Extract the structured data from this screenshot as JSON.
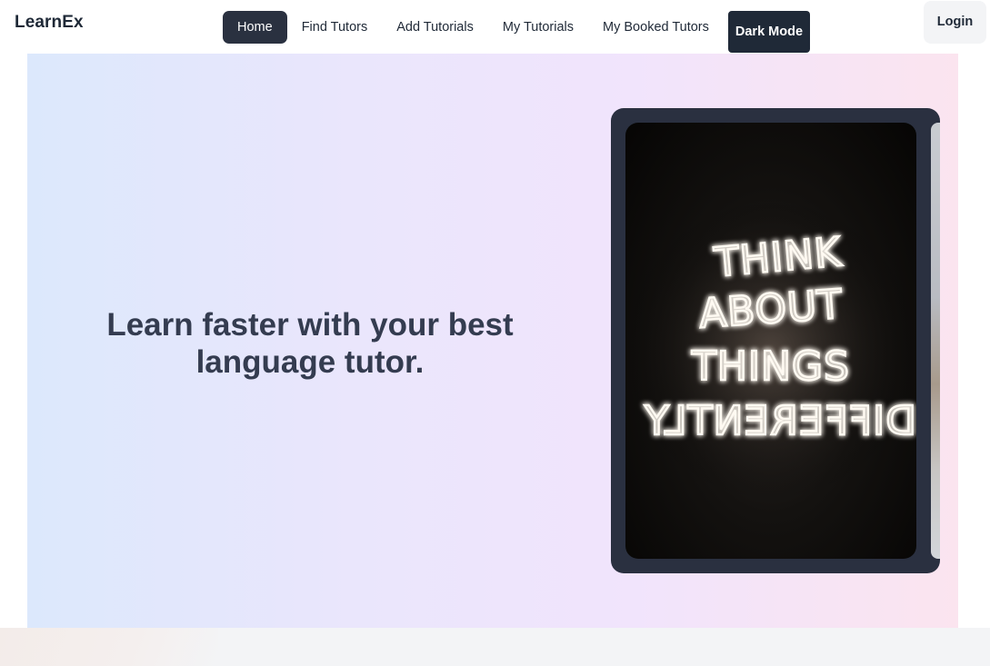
{
  "brand": {
    "name": "LearnEx"
  },
  "nav": {
    "links": [
      {
        "label": "Home",
        "active": true
      },
      {
        "label": "Find Tutors",
        "active": false
      },
      {
        "label": "Add Tutorials",
        "active": false
      },
      {
        "label": "My Tutorials",
        "active": false
      },
      {
        "label": "My Booked Tutors",
        "active": false
      }
    ],
    "dark_mode_label": "Dark Mode",
    "login_label": "Login"
  },
  "hero": {
    "headline_line1": "Learn faster with your best",
    "headline_line2": "language tutor.",
    "slide_image_text": [
      "THINK",
      "ABOUT",
      "THINGS",
      "DIFFERENTLY"
    ]
  },
  "colors": {
    "primary_dark": "#1f2937",
    "active_nav": "#2a3140",
    "headline": "#343c50",
    "carousel_frame": "#2a3040"
  }
}
